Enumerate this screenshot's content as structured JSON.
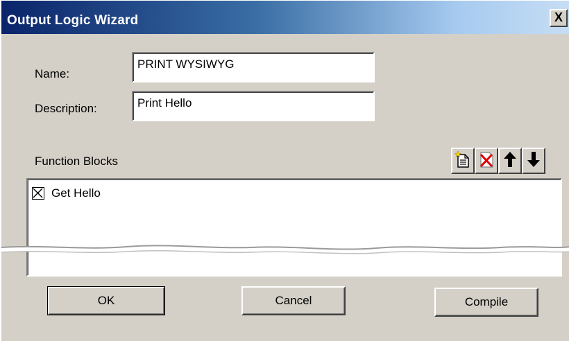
{
  "window": {
    "title": "Output Logic Wizard",
    "close_label": "X"
  },
  "form": {
    "name_label": "Name:",
    "name_value": "PRINT WYSIWYG",
    "description_label": "Description:",
    "description_value": "Print Hello"
  },
  "function_blocks": {
    "label": "Function Blocks",
    "toolbar": [
      "new-document-icon",
      "delete-icon",
      "arrow-up-icon",
      "arrow-down-icon"
    ],
    "items": [
      {
        "label": "Get Hello",
        "checked": true
      }
    ]
  },
  "buttons": {
    "ok": "OK",
    "cancel": "Cancel",
    "compile": "Compile"
  },
  "colors": {
    "face": "#d4d0c8",
    "title_start": "#0a246a",
    "title_end": "#a6caf0",
    "delete_red": "#e00000"
  }
}
